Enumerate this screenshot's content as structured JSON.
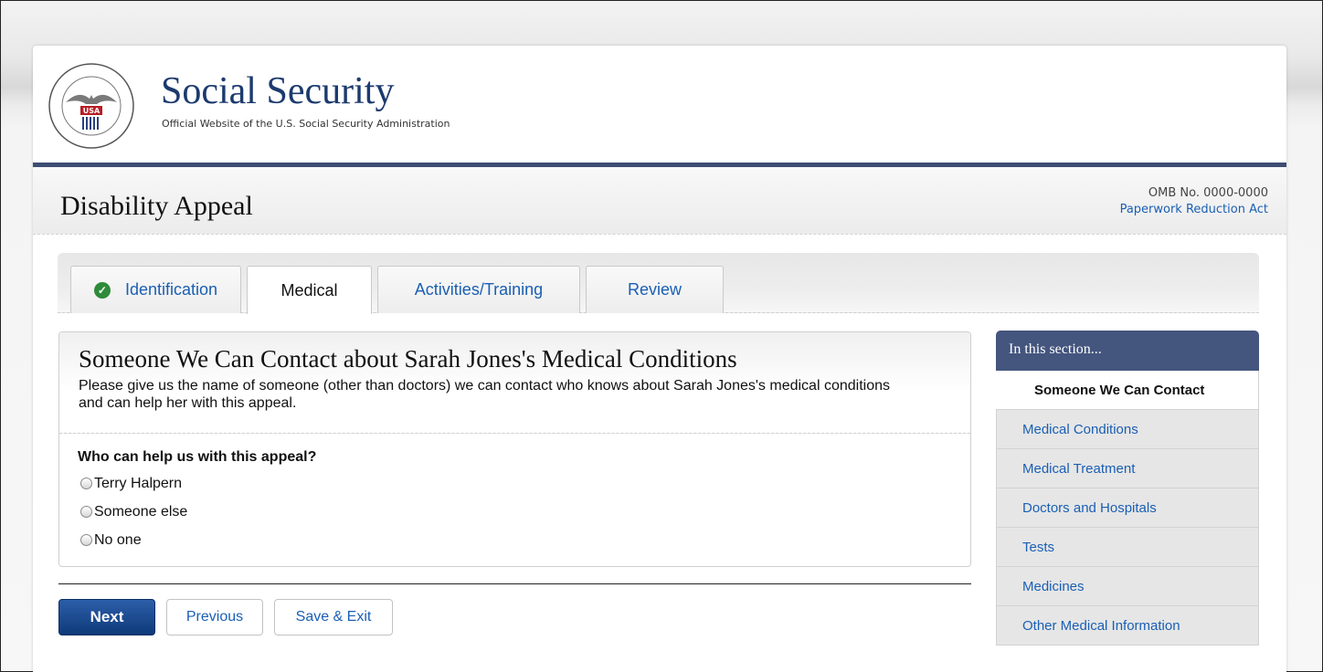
{
  "header": {
    "brand_title": "Social Security",
    "brand_subtitle": "Official Website of the U.S. Social Security Administration",
    "seal_icon": "ssa-seal-icon"
  },
  "page": {
    "title": "Disability Appeal",
    "omb_number": "OMB No. 0000-0000",
    "paperwork_link": "Paperwork Reduction Act"
  },
  "tabs": [
    {
      "label": "Identification",
      "completed": true
    },
    {
      "label": "Medical",
      "active": true
    },
    {
      "label": "Activities/Training"
    },
    {
      "label": "Review"
    }
  ],
  "main": {
    "title": "Someone We Can Contact about Sarah Jones's Medical Conditions",
    "description": "Please give us the name of someone (other than doctors) we can contact who knows about Sarah Jones's medical conditions and can help her with this appeal.",
    "question": "Who can help us with this appeal?",
    "options": [
      "Terry Halpern",
      "Someone else",
      "No one"
    ]
  },
  "buttons": {
    "next": "Next",
    "previous": "Previous",
    "save_exit": "Save & Exit"
  },
  "sidebar": {
    "heading": "In this section...",
    "items": [
      {
        "label": "Someone We Can Contact",
        "active": true
      },
      {
        "label": "Medical Conditions"
      },
      {
        "label": "Medical Treatment"
      },
      {
        "label": "Doctors and Hospitals"
      },
      {
        "label": "Tests"
      },
      {
        "label": "Medicines"
      },
      {
        "label": "Other Medical Information"
      }
    ]
  },
  "colors": {
    "brand_navy": "#1c3a6e",
    "header_rule": "#3d4d73",
    "link_blue": "#1a5fb4",
    "check_green": "#2e8b3a"
  }
}
